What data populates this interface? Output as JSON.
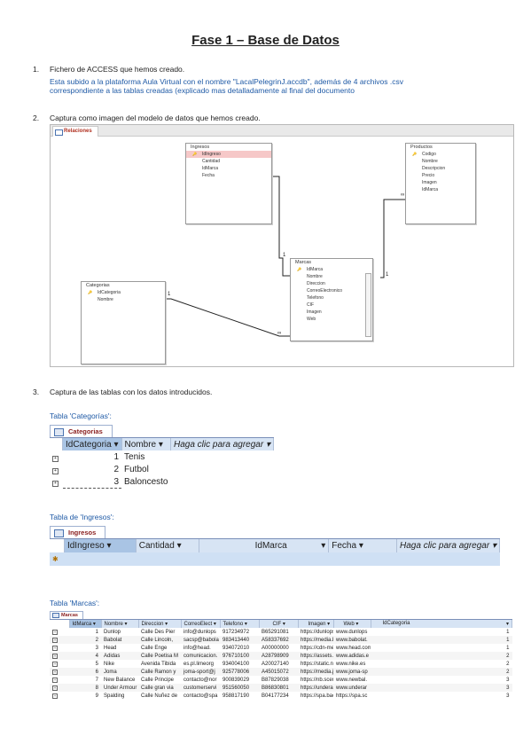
{
  "title": "Fase 1 – Base de Datos",
  "items": [
    {
      "num": "1.",
      "text": "Fichero de ACCESS que hemos creado."
    },
    {
      "num": "2.",
      "text": "Captura como imagen del modelo de datos que hemos creado."
    },
    {
      "num": "3.",
      "text": "Captura de las tablas con los datos introducidos."
    }
  ],
  "para1_line1": "Esta subido a la plataforma Aula Virtual con el nombre \"LacalPelegrinJ.accdb\", además de 4 archivos .csv",
  "para1_line2": "correspondiente a las tablas creadas (explicado mas detalladamente al final del documento",
  "diagram": {
    "tab": "Relaciones",
    "tables": {
      "ingresos": {
        "title": "Ingresos",
        "fields": [
          "IdIngreso",
          "Cantidad",
          "IdMarca",
          "Fecha"
        ]
      },
      "productos": {
        "title": "Productos",
        "fields": [
          "Codigo",
          "Nombre",
          "Descripcion",
          "Precio",
          "Imagen",
          "IdMarca"
        ]
      },
      "categorias": {
        "title": "Categorias",
        "fields": [
          "IdCategoria",
          "Nombre"
        ]
      },
      "marcas": {
        "title": "Marcas",
        "fields": [
          "IdMarca",
          "Nombre",
          "Direccion",
          "CorreoElectronico",
          "Telefono",
          "CIF",
          "Imagen",
          "Web"
        ]
      }
    }
  },
  "captions": {
    "categorias": "Tabla 'Categorías':",
    "ingresos": "Tabla de 'Ingresos':",
    "marcas": "Tabla 'Marcas':"
  },
  "categorias": {
    "tab": "Categorias",
    "headers": [
      "IdCategoria",
      "Nombre",
      "Haga clic para agregar"
    ],
    "rows": [
      {
        "id": "1",
        "nombre": "Tenis"
      },
      {
        "id": "2",
        "nombre": "Futbol"
      },
      {
        "id": "3",
        "nombre": "Baloncesto"
      }
    ]
  },
  "ingresos": {
    "tab": "Ingresos",
    "headers": [
      "IdIngreso",
      "Cantidad",
      "IdMarca",
      "Fecha",
      "Haga clic para agregar"
    ]
  },
  "marcas": {
    "tab": "Marcas",
    "headers": [
      "IdMarca",
      "Nombre",
      "Direccion",
      "CorreoElect",
      "Telefono",
      "CIF",
      "Imagen",
      "Web",
      "IdCategoria"
    ],
    "rows": [
      {
        "id": "1",
        "nombre": "Dunlop",
        "dir": "Calle Des Pier",
        "correo": "info@dunlops",
        "tel": "917234972",
        "cif": "B65291081",
        "img": "https://dunlops",
        "web": "www.dunlops",
        "cat": "1"
      },
      {
        "id": "2",
        "nombre": "Babolat",
        "dir": "Calle Lincoln,",
        "correo": "sacsp@babola",
        "tel": "983413440",
        "cif": "A58337692",
        "img": "https://media.b",
        "web": "www.babolat.",
        "cat": "1"
      },
      {
        "id": "3",
        "nombre": "Head",
        "dir": "Calle Enge",
        "correo": "info@head.",
        "tel": "934072010",
        "cif": "A00000000",
        "img": "https://cdn-medi",
        "web": "www.head.com",
        "cat": "1"
      },
      {
        "id": "4",
        "nombre": "Adidas",
        "dir": "Calle Poetisa M",
        "correo": "comunicacion.",
        "tel": "976710100",
        "cif": "A28798909",
        "img": "https://assets.a",
        "web": "www.adidas.e",
        "cat": "2"
      },
      {
        "id": "5",
        "nombre": "Nike",
        "dir": "Avenida Tibida",
        "correo": "es.pl.limeorg",
        "tel": "934004100",
        "cif": "A20027140",
        "img": "https://static.ni",
        "web": "www.nike.es",
        "cat": "2"
      },
      {
        "id": "6",
        "nombre": "Joma",
        "dir": "Calle Ramon y",
        "correo": "joma-sport@j",
        "tel": "925778006",
        "cif": "A45015072",
        "img": "https://media.jo",
        "web": "www.joma-sp",
        "cat": "2"
      },
      {
        "id": "7",
        "nombre": "New Balance",
        "dir": "Calle Principe",
        "correo": "contacto@nor",
        "tel": "900839029",
        "cif": "B87829038",
        "img": "https://nb.scen",
        "web": "www.newbal.",
        "cat": "3"
      },
      {
        "id": "8",
        "nombre": "Under Armour",
        "dir": "Calle gran via",
        "correo": "customerservi",
        "tel": "951560050",
        "cif": "B86830801",
        "img": "https://underar",
        "web": "www.underar",
        "cat": "3"
      },
      {
        "id": "9",
        "nombre": "Spalding",
        "dir": "Calle Nuñez de",
        "correo": "contacto@spa",
        "tel": "958817190",
        "cif": "B04177234",
        "img": "https://spa.back",
        "web": "https://spa.sc",
        "cat": "3"
      }
    ]
  }
}
